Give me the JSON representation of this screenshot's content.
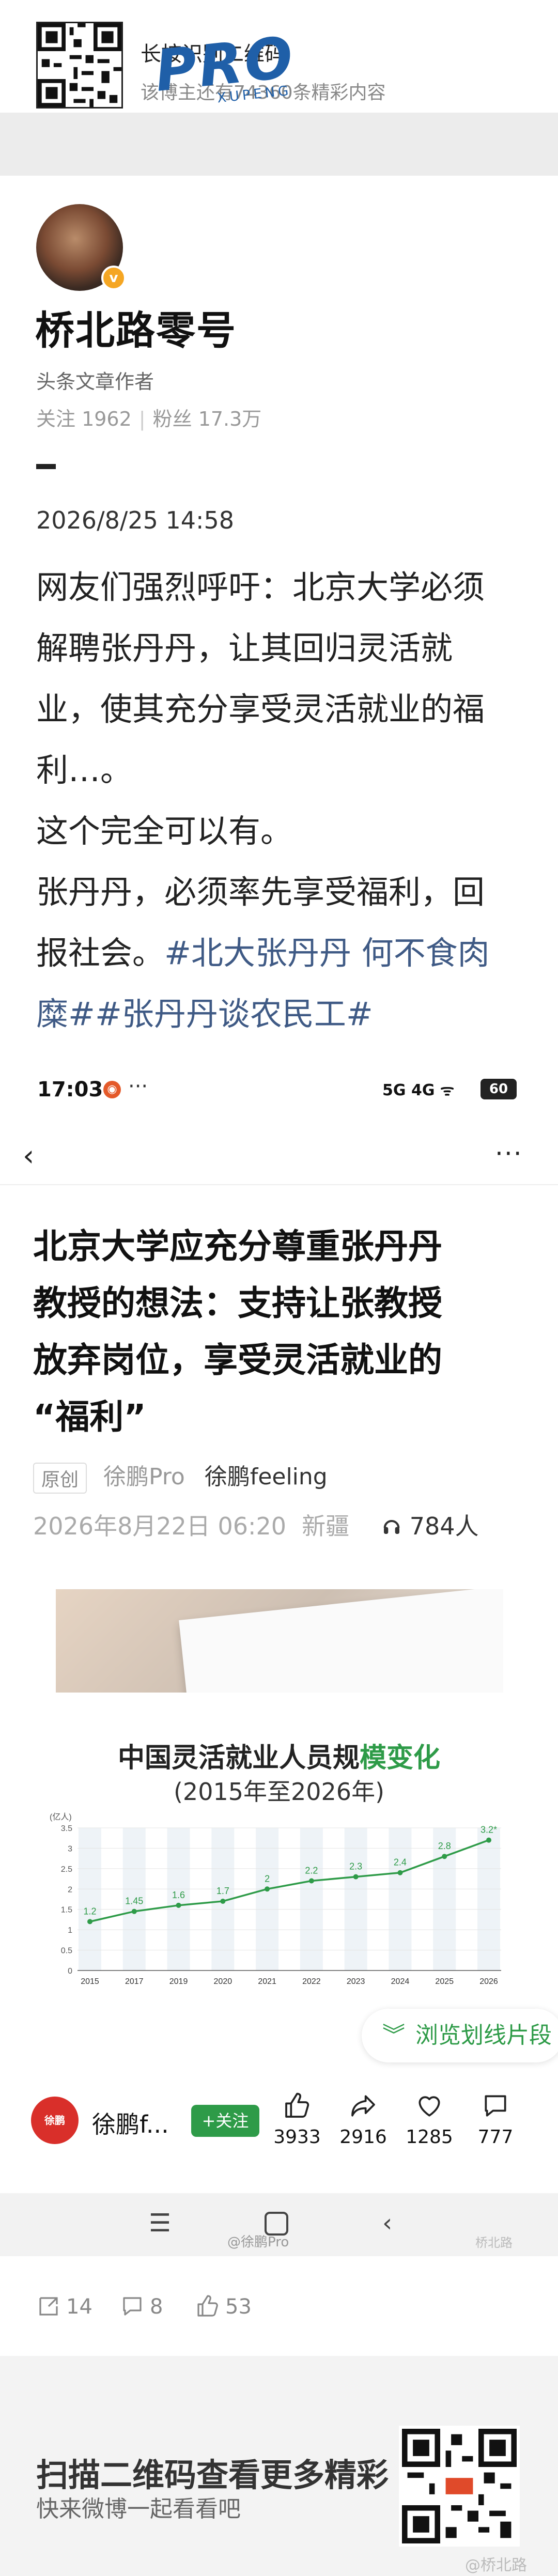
{
  "qr_header": {
    "title": "长按识别二维码",
    "subtitle": "该博主还有74360条精彩内容"
  },
  "post": {
    "author_name": "桥北路零号",
    "author_role": "头条文章作者",
    "follow_label": "关注 1962",
    "fans_label": "粉丝 17.3万",
    "verified_badge": "v",
    "time": "2026/8/25 14:58",
    "body_lines": [
      "网友们强烈呼吁：北京大学必须",
      "解聘张丹丹，让其回归灵活就",
      "业，使其充分享受灵活就业的福",
      "利…。",
      "这个完全可以有。",
      "张丹丹，必须率先享受福利，回",
      "报社会。"
    ],
    "hashtag_line1": "#北大张丹丹 何不食肉",
    "hashtag_line2_prefix": "糜#",
    "hashtag_line2": "#张丹丹谈农民工#"
  },
  "screenshot": {
    "status_time": "17:03",
    "status_more": "···",
    "status_icons": "5G 4G ᯤ",
    "battery": "60",
    "more_dots": "···",
    "article_title_lines": [
      "北京大学应充分尊重张丹丹",
      "教授的想法：支持让张教授",
      "放弃岗位，享受灵活就业的",
      "“福利”"
    ],
    "badge_original": "原创",
    "source": "徐鹏Pro",
    "author": "徐鹏feeling",
    "date_time": "2026年8月22日 06:20",
    "location": "新疆",
    "listen_count": "784人",
    "banner_logo": "PRO",
    "banner_sub": "XUPENG",
    "chart_title_plain": "中国灵活就业人员规",
    "chart_title_highlight": "模变化",
    "chart_subtitle": "(2015年至2026年)",
    "float_button": "浏览划线片段",
    "bottom_author": "徐鹏f...",
    "bottom_avatar_text": "徐鹏feeling",
    "follow_button": "+关注",
    "like_count": "3933",
    "share_count": "2916",
    "heart_count": "1285",
    "comment_count": "777",
    "nav_watermark": "@徐鹏Pro",
    "nav_watermark2": "桥北路"
  },
  "chart_data": {
    "type": "line",
    "title": "中国灵活就业人员规模变化",
    "subtitle": "(2015年至2026年)",
    "ylabel": "(亿人)",
    "categories": [
      "2015",
      "2017",
      "2019",
      "2020",
      "2021",
      "2022",
      "2023",
      "2024",
      "2025",
      "2026"
    ],
    "values": [
      1.2,
      1.45,
      1.6,
      1.7,
      2.0,
      2.2,
      2.3,
      2.4,
      2.8,
      3.2
    ],
    "data_labels": [
      "1.2",
      "1.45",
      "1.6",
      "1.7",
      "2",
      "2.2",
      "2.3",
      "2.4",
      "2.8",
      "3.2*"
    ],
    "yticks": [
      "0",
      "0.5",
      "1",
      "1.5",
      "2",
      "2.5",
      "3",
      "3.5"
    ],
    "ylim": [
      0,
      3.5
    ],
    "color": "#2e9b48"
  },
  "post_actions": {
    "repost": "14",
    "comment": "8",
    "like": "53"
  },
  "footer": {
    "title": "扫描二维码查看更多精彩",
    "subtitle": "快来微博一起看看吧",
    "watermark": "@桥北路"
  }
}
